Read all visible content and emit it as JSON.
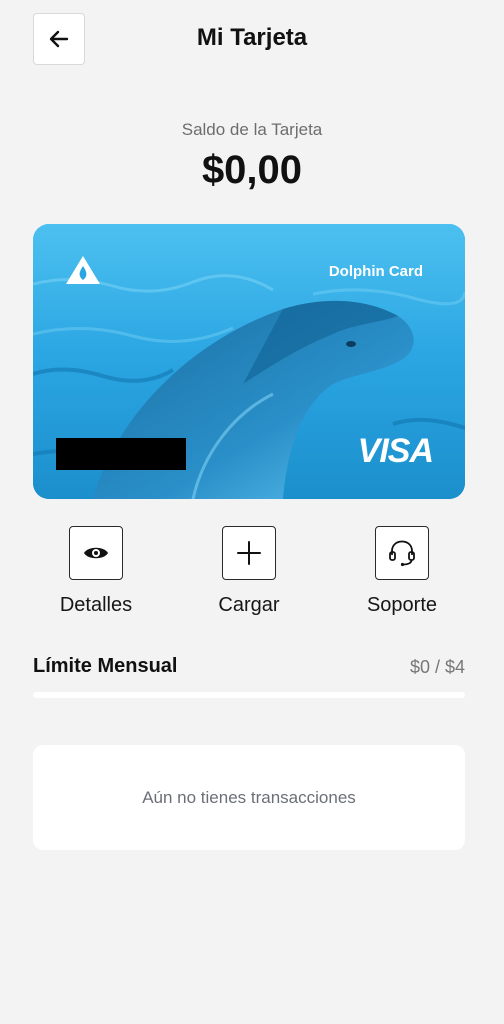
{
  "header": {
    "title": "Mi Tarjeta",
    "back_icon": "arrow-left-icon"
  },
  "balance": {
    "label": "Saldo de la Tarjeta",
    "value": "$0,00"
  },
  "card": {
    "brand_name": "Dolphin Card",
    "network": "VISA",
    "logo_icon": "drop-logo-icon",
    "background_image": "dolphin-photo",
    "number_masked": true,
    "accent_color": "#1f9fde"
  },
  "actions": [
    {
      "label": "Detalles",
      "icon": "eye-icon"
    },
    {
      "label": "Cargar",
      "icon": "plus-icon"
    },
    {
      "label": "Soporte",
      "icon": "headset-icon"
    }
  ],
  "monthly_limit": {
    "title": "Límite Mensual",
    "value_text": "$0 / $4",
    "progress_fraction": 0
  },
  "transactions": {
    "empty_message": "Aún no tienes transacciones"
  }
}
